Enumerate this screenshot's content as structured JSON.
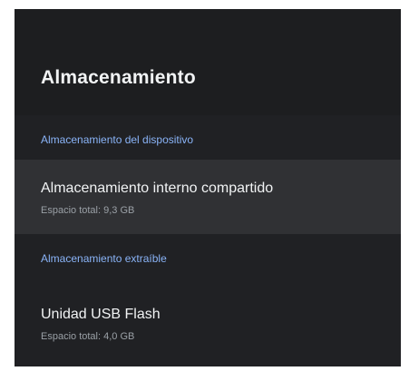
{
  "screen": {
    "title": "Almacenamiento"
  },
  "sections": [
    {
      "header": "Almacenamiento del dispositivo",
      "items": [
        {
          "title": "Almacenamiento interno compartido",
          "subtitle": "Espacio total: 9,3 GB",
          "focused": true
        }
      ]
    },
    {
      "header": "Almacenamiento extraíble",
      "items": [
        {
          "title": "Unidad USB Flash",
          "subtitle": "Espacio total: 4,0 GB",
          "focused": false
        }
      ]
    }
  ],
  "colors": {
    "background": "#202124",
    "header_background": "#1d1e20",
    "focused_row": "#303134",
    "section_accent": "#8ab4f8",
    "primary_text": "#f1f3f4",
    "secondary_text": "#9aa0a6"
  }
}
